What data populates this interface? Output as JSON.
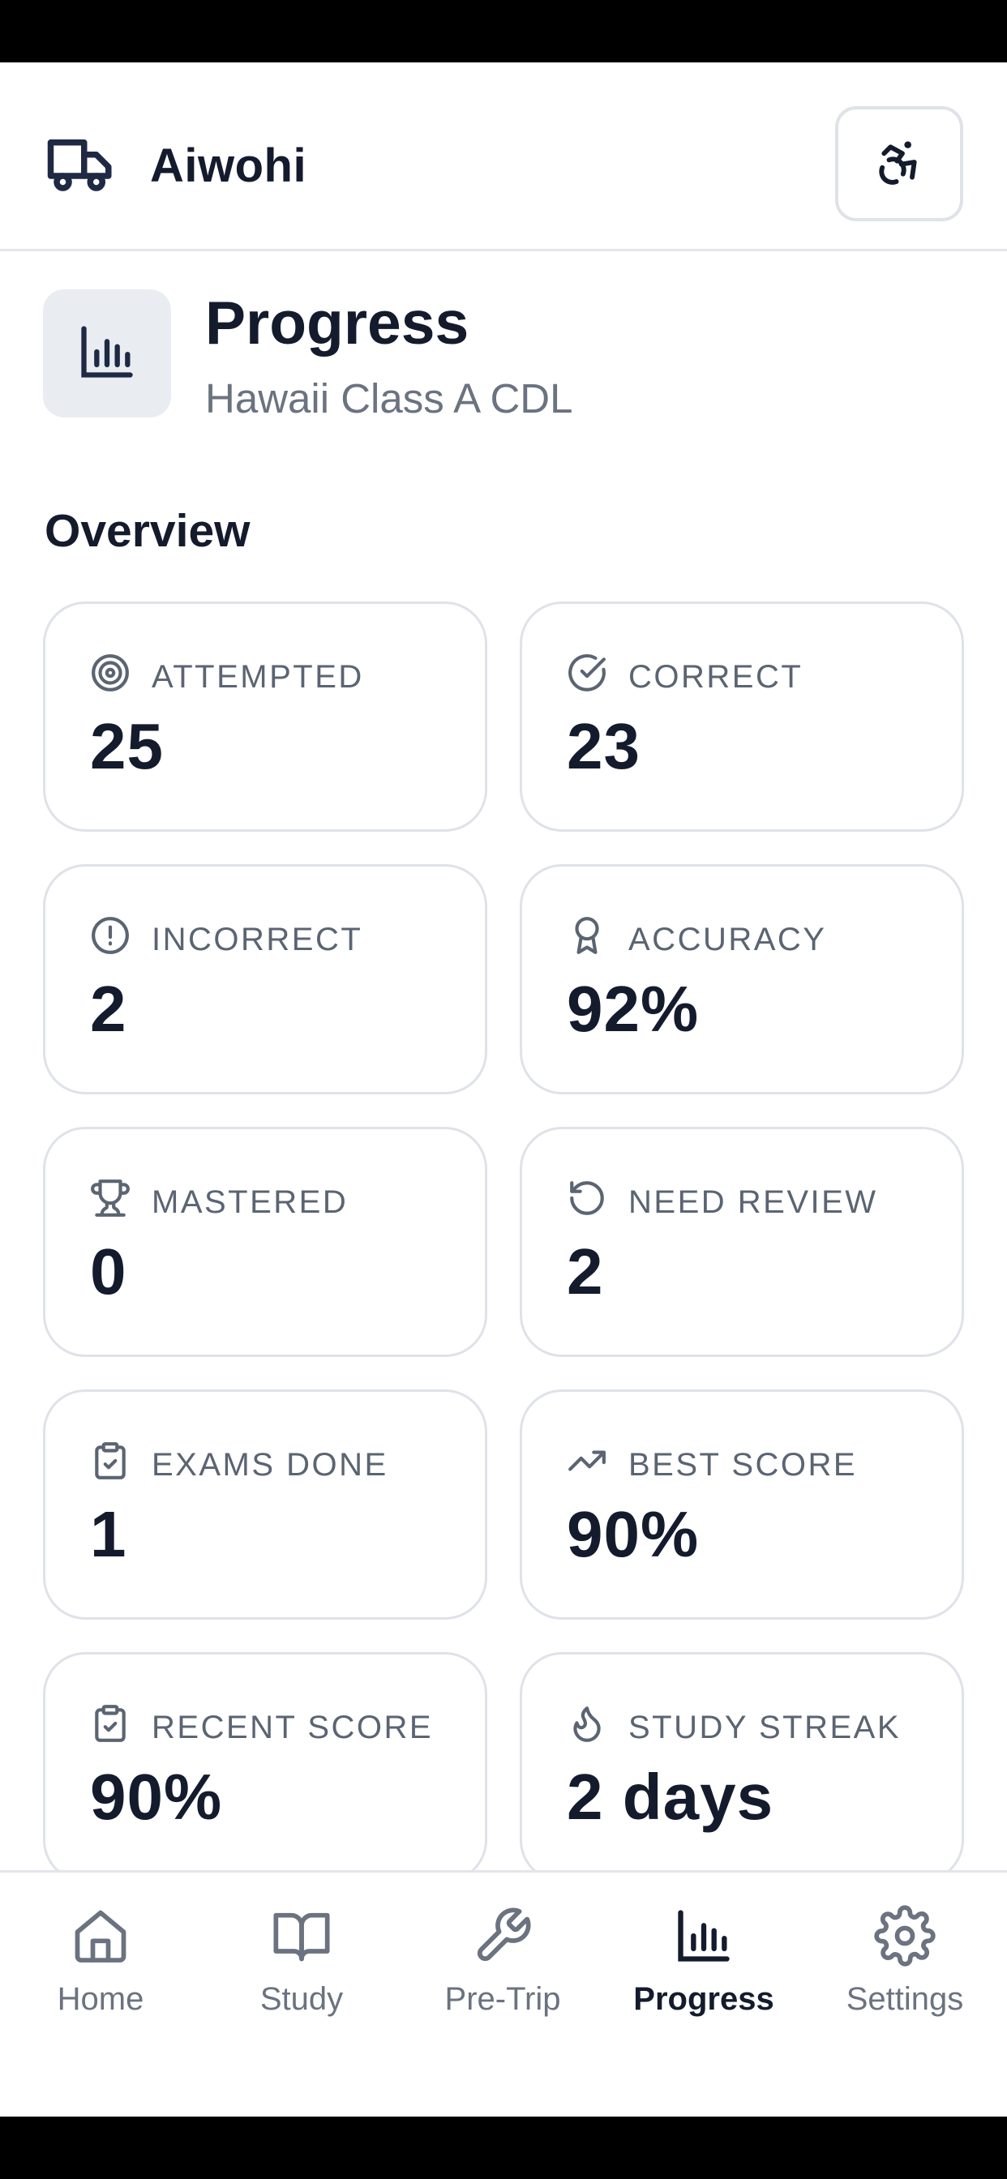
{
  "header": {
    "brand_name": "Aiwohi",
    "brand_icon": "truck-icon",
    "accessibility_icon": "accessibility-icon"
  },
  "page": {
    "title": "Progress",
    "subtitle": "Hawaii Class A CDL",
    "icon": "bar-chart-icon"
  },
  "overview": {
    "title": "Overview",
    "stats": [
      {
        "icon": "target-icon",
        "label": "ATTEMPTED",
        "value": "25"
      },
      {
        "icon": "check-circle-icon",
        "label": "CORRECT",
        "value": "23"
      },
      {
        "icon": "alert-circle-icon",
        "label": "INCORRECT",
        "value": "2"
      },
      {
        "icon": "award-icon",
        "label": "ACCURACY",
        "value": "92%"
      },
      {
        "icon": "trophy-icon",
        "label": "MASTERED",
        "value": "0"
      },
      {
        "icon": "rotate-ccw-icon",
        "label": "NEED REVIEW",
        "value": "2"
      },
      {
        "icon": "clipboard-check-icon",
        "label": "EXAMS DONE",
        "value": "1"
      },
      {
        "icon": "trending-up-icon",
        "label": "BEST SCORE",
        "value": "90%"
      },
      {
        "icon": "clipboard-check-icon",
        "label": "RECENT SCORE",
        "value": "90%"
      },
      {
        "icon": "flame-icon",
        "label": "STUDY STREAK",
        "value": "2 days"
      }
    ]
  },
  "nav": {
    "active": "Progress",
    "items": [
      {
        "icon": "home-icon",
        "label": "Home"
      },
      {
        "icon": "book-open-icon",
        "label": "Study"
      },
      {
        "icon": "wrench-icon",
        "label": "Pre-Trip"
      },
      {
        "icon": "bar-chart-icon",
        "label": "Progress"
      },
      {
        "icon": "gear-icon",
        "label": "Settings"
      }
    ]
  },
  "colors": {
    "text_primary": "#141b2d",
    "text_secondary": "#6b7280",
    "border": "#dfe2e8",
    "icon_tile_bg": "#e9ecf1"
  }
}
